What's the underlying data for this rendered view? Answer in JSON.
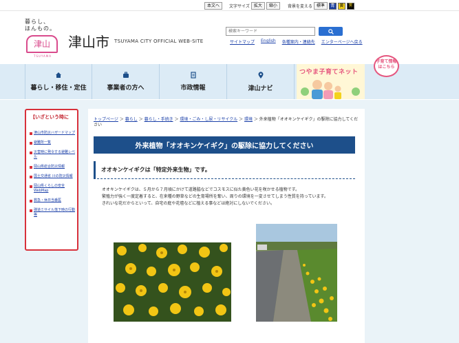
{
  "topbar": {
    "home_label": "本文へ",
    "text_size_label": "文字サイズ",
    "enlarge_label": "拡大",
    "shrink_label": "縮小",
    "bg_color_label": "背景を変える",
    "color_options": [
      "標準",
      "青",
      "黄",
      "黒"
    ]
  },
  "header": {
    "logo_tagline_line1": "暮らし、",
    "logo_tagline_line2": "ほんもの。",
    "logo_mark_text": "津山",
    "logo_mark_sub": "TSUYAMA",
    "city_name": "津山市",
    "site_name": "TSUYAMA CITY OFFICIAL WEB-SITE",
    "search_placeholder": "検索キーワード",
    "quick_links": [
      "サイトマップ",
      "English",
      "各種案内・連絡先",
      "エンターページへ戻る"
    ]
  },
  "nav": {
    "items": [
      {
        "label": "暮らし・移住・定住",
        "icon": "home-icon"
      },
      {
        "label": "事業者の方へ",
        "icon": "briefcase-icon"
      },
      {
        "label": "市政情報",
        "icon": "document-icon"
      },
      {
        "label": "津山ナビ",
        "icon": "map-pin-icon"
      }
    ],
    "banner_title": "つやま子育てネット",
    "banner_bubble": "子育て情報はこちら"
  },
  "sidebar": {
    "title": "【いざという時に",
    "items": [
      "津山市防災ハザードマップ",
      "避難所一覧",
      "災害時に発令する避難レベル",
      "岡山県総合防災情報",
      "国土交通省 川の防災情報",
      "岡山県くらしの安全WebMap",
      "救急・休日当番医",
      "弾道ミサイル落下時の行動等"
    ]
  },
  "article": {
    "breadcrumb": [
      "トップページ",
      "暮らし",
      "暮らし・手続き",
      "環境・ごみ・し尿・リサイクル",
      "環境",
      "外来植物「オオキンケイギク」の駆除に協力してください"
    ],
    "title": "外来植物「オオキンケイギク」の駆除に協力してください",
    "section_heading": "オオキンケイギクは「特定外来生物」です。",
    "paragraphs": [
      "オオキンケイギクは、５月から７月頃にかけて道路脇などでコスモスに似た黄色い花を咲かせる植物です。",
      "繁殖力が強く一度定着すると、在来種の野草などの生育場所を奪い、周りの環境を一変させてしまう性質を持っています。",
      "きれいな花だからといって、自宅の庭や花壇などに植える事などは絶対にしないでください。"
    ]
  },
  "colors": {
    "nav_bg": "#dcebf6",
    "title_bar": "#1d4f8a",
    "sidebar_border": "#d8303a",
    "link": "#1a3fa8",
    "search_button": "#2a6fd1"
  }
}
